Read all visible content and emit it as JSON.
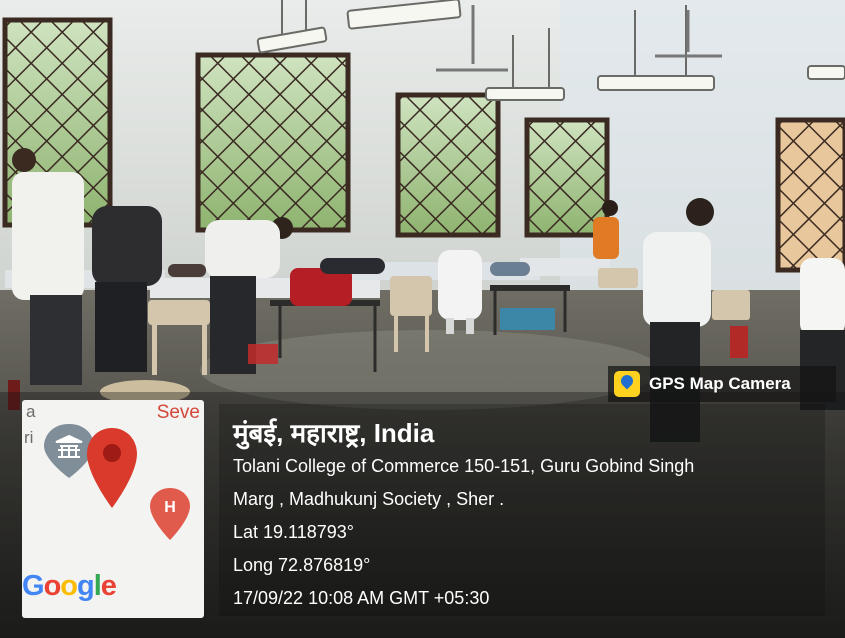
{
  "gps_badge": {
    "label": "GPS Map Camera",
    "icon": "map-pin-icon"
  },
  "map_thumb": {
    "labels": {
      "a": "a",
      "ri": "ri",
      "seve": "Seve"
    },
    "google_letters": [
      {
        "ch": "G",
        "color": "#4285F4"
      },
      {
        "ch": "o",
        "color": "#EA4335"
      },
      {
        "ch": "o",
        "color": "#FBBC05"
      },
      {
        "ch": "g",
        "color": "#4285F4"
      },
      {
        "ch": "l",
        "color": "#34A853"
      },
      {
        "ch": "e",
        "color": "#EA4335"
      }
    ],
    "icons": [
      "museum-icon",
      "location-pin-icon",
      "hospital-icon"
    ]
  },
  "location": {
    "heading": "मुंबई, महाराष्ट्र, India",
    "address_line1": "Tolani College of Commerce 150-151, Guru Gobind Singh",
    "address_line2": "Marg , Madhukunj Society , Sher .",
    "lat": "Lat 19.118793°",
    "long": "Long 72.876819°",
    "datetime": "17/09/22 10:08 AM GMT +05:30"
  },
  "scene": {
    "description_icons": [
      "ceiling-light-icon",
      "ceiling-fan-icon",
      "window-icon",
      "bed-icon",
      "person-icon"
    ]
  }
}
